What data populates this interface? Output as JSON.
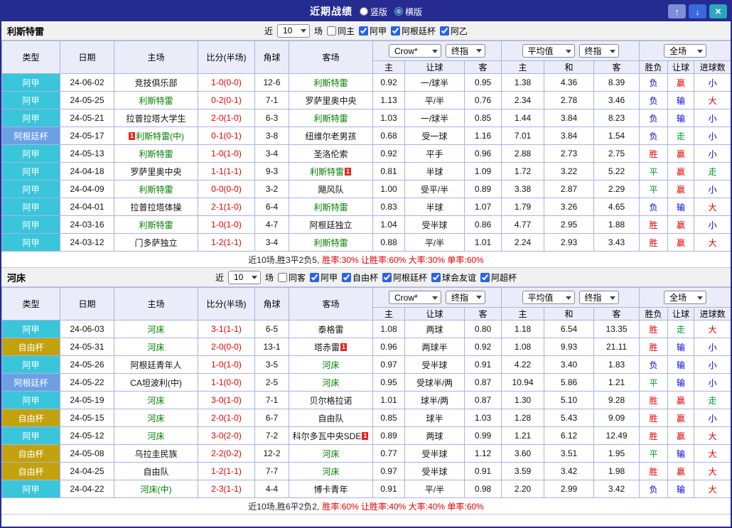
{
  "titlebar": {
    "title": "近期战绩",
    "layout_options": [
      {
        "label": "竖版",
        "checked": false
      },
      {
        "label": "横版",
        "checked": true
      }
    ],
    "buttons": {
      "up": "↑",
      "down": "↓",
      "close": "×"
    }
  },
  "table": {
    "main_headers": [
      "类型",
      "日期",
      "主场",
      "比分(半场)",
      "角球",
      "客场"
    ],
    "asia_source": "Crow*",
    "asia_final": "终指",
    "europe_source": "平均值",
    "europe_final": "终指",
    "scope": "全场",
    "sub_headers": [
      "主",
      "让球",
      "客",
      "主",
      "和",
      "客",
      "胜负",
      "让球",
      "进球数"
    ]
  },
  "colors": {
    "accent": "#262b8f",
    "focus_team": "#008000",
    "score": "#e60000",
    "league": {
      "阿甲": "#39c5da",
      "阿根廷杯": "#6ba0e5",
      "自由杯": "#c2a20d"
    },
    "result": {
      "胜": "#e60000",
      "平": "#009933",
      "负": "#0000e1",
      "赢": "#e60000",
      "输": "#0000e1",
      "走": "#009933",
      "大": "#e60000",
      "小": "#0000e1"
    }
  },
  "sections": [
    {
      "team": "利斯特雷",
      "filter": {
        "near": "近",
        "count": "10",
        "games": "场",
        "options": [
          {
            "label": "同主",
            "checked": false
          },
          {
            "label": "阿甲",
            "checked": true
          },
          {
            "label": "阿根廷杯",
            "checked": true
          },
          {
            "label": "阿乙",
            "checked": true
          }
        ]
      },
      "rows": [
        {
          "league": "阿甲",
          "date": "24-06-02",
          "home": "竞技俱乐部",
          "home_focus": false,
          "home_card": "",
          "score": "1-0(0-0)",
          "corner": "12-6",
          "away": "利斯特雷",
          "away_focus": true,
          "away_card": "",
          "ah": [
            "0.92",
            "一/球半",
            "0.95"
          ],
          "eu": [
            "1.38",
            "4.36",
            "8.39"
          ],
          "res": [
            "负",
            "赢",
            "小"
          ]
        },
        {
          "league": "阿甲",
          "date": "24-05-25",
          "home": "利斯特雷",
          "home_focus": true,
          "home_card": "",
          "score": "0-2(0-1)",
          "corner": "7-1",
          "away": "罗萨里奥中央",
          "away_focus": false,
          "away_card": "",
          "ah": [
            "1.13",
            "平/半",
            "0.76"
          ],
          "eu": [
            "2.34",
            "2.78",
            "3.46"
          ],
          "res": [
            "负",
            "输",
            "大"
          ]
        },
        {
          "league": "阿甲",
          "date": "24-05-21",
          "home": "拉普拉塔大学生",
          "home_focus": false,
          "home_card": "",
          "score": "2-0(1-0)",
          "corner": "6-3",
          "away": "利斯特雷",
          "away_focus": true,
          "away_card": "",
          "ah": [
            "1.03",
            "一/球半",
            "0.85"
          ],
          "eu": [
            "1.44",
            "3.84",
            "8.23"
          ],
          "res": [
            "负",
            "输",
            "小"
          ]
        },
        {
          "league": "阿根廷杯",
          "date": "24-05-17",
          "home": "利斯特雷(中)",
          "home_focus": true,
          "home_card": "pre",
          "score": "0-1(0-1)",
          "corner": "3-8",
          "away": "纽维尔老男孩",
          "away_focus": false,
          "away_card": "",
          "ah": [
            "0.68",
            "受一球",
            "1.16"
          ],
          "eu": [
            "7.01",
            "3.84",
            "1.54"
          ],
          "res": [
            "负",
            "走",
            "小"
          ]
        },
        {
          "league": "阿甲",
          "date": "24-05-13",
          "home": "利斯特雷",
          "home_focus": true,
          "home_card": "",
          "score": "1-0(1-0)",
          "corner": "3-4",
          "away": "圣洛伦索",
          "away_focus": false,
          "away_card": "",
          "ah": [
            "0.92",
            "平手",
            "0.96"
          ],
          "eu": [
            "2.88",
            "2.73",
            "2.75"
          ],
          "res": [
            "胜",
            "赢",
            "小"
          ]
        },
        {
          "league": "阿甲",
          "date": "24-04-18",
          "home": "罗萨里奥中央",
          "home_focus": false,
          "home_card": "",
          "score": "1-1(1-1)",
          "corner": "9-3",
          "away": "利斯特雷",
          "away_focus": true,
          "away_card": "post",
          "ah": [
            "0.81",
            "半球",
            "1.09"
          ],
          "eu": [
            "1.72",
            "3.22",
            "5.22"
          ],
          "res": [
            "平",
            "赢",
            "走"
          ]
        },
        {
          "league": "阿甲",
          "date": "24-04-09",
          "home": "利斯特雷",
          "home_focus": true,
          "home_card": "",
          "score": "0-0(0-0)",
          "corner": "3-2",
          "away": "飓风队",
          "away_focus": false,
          "away_card": "",
          "ah": [
            "1.00",
            "受平/半",
            "0.89"
          ],
          "eu": [
            "3.38",
            "2.87",
            "2.29"
          ],
          "res": [
            "平",
            "赢",
            "小"
          ]
        },
        {
          "league": "阿甲",
          "date": "24-04-01",
          "home": "拉普拉塔体操",
          "home_focus": false,
          "home_card": "",
          "score": "2-1(1-0)",
          "corner": "6-4",
          "away": "利斯特雷",
          "away_focus": true,
          "away_card": "",
          "ah": [
            "0.83",
            "半球",
            "1.07"
          ],
          "eu": [
            "1.79",
            "3.26",
            "4.65"
          ],
          "res": [
            "负",
            "输",
            "大"
          ]
        },
        {
          "league": "阿甲",
          "date": "24-03-16",
          "home": "利斯特雷",
          "home_focus": true,
          "home_card": "",
          "score": "1-0(1-0)",
          "corner": "4-7",
          "away": "阿根廷独立",
          "away_focus": false,
          "away_card": "",
          "ah": [
            "1.04",
            "受半球",
            "0.86"
          ],
          "eu": [
            "4.77",
            "2.95",
            "1.88"
          ],
          "res": [
            "胜",
            "赢",
            "小"
          ]
        },
        {
          "league": "阿甲",
          "date": "24-03-12",
          "home": "门多萨独立",
          "home_focus": false,
          "home_card": "",
          "score": "1-2(1-1)",
          "corner": "3-4",
          "away": "利斯特雷",
          "away_focus": true,
          "away_card": "",
          "ah": [
            "0.88",
            "平/半",
            "1.01"
          ],
          "eu": [
            "2.24",
            "2.93",
            "3.43"
          ],
          "res": [
            "胜",
            "赢",
            "大"
          ]
        }
      ],
      "summary_prefix": "近10场,胜3平2负5,",
      "summary_stats": "胜率:30% 让胜率:60% 大率:30% 单率:60%"
    },
    {
      "team": "河床",
      "filter": {
        "near": "近",
        "count": "10",
        "games": "场",
        "options": [
          {
            "label": "同客",
            "checked": false
          },
          {
            "label": "阿甲",
            "checked": true
          },
          {
            "label": "自由杯",
            "checked": true
          },
          {
            "label": "阿根廷杯",
            "checked": true
          },
          {
            "label": "球会友谊",
            "checked": true
          },
          {
            "label": "阿超杯",
            "checked": true
          }
        ]
      },
      "rows": [
        {
          "league": "阿甲",
          "date": "24-06-03",
          "home": "河床",
          "home_focus": true,
          "home_card": "",
          "score": "3-1(1-1)",
          "corner": "6-5",
          "away": "泰格雷",
          "away_focus": false,
          "away_card": "",
          "ah": [
            "1.08",
            "两球",
            "0.80"
          ],
          "eu": [
            "1.18",
            "6.54",
            "13.35"
          ],
          "res": [
            "胜",
            "走",
            "大"
          ]
        },
        {
          "league": "自由杯",
          "date": "24-05-31",
          "home": "河床",
          "home_focus": true,
          "home_card": "",
          "score": "2-0(0-0)",
          "corner": "13-1",
          "away": "塔赤雷",
          "away_focus": false,
          "away_card": "post",
          "ah": [
            "0.96",
            "两球半",
            "0.92"
          ],
          "eu": [
            "1.08",
            "9.93",
            "21.11"
          ],
          "res": [
            "胜",
            "输",
            "小"
          ]
        },
        {
          "league": "阿甲",
          "date": "24-05-26",
          "home": "阿根廷青年人",
          "home_focus": false,
          "home_card": "",
          "score": "1-0(1-0)",
          "corner": "3-5",
          "away": "河床",
          "away_focus": true,
          "away_card": "",
          "ah": [
            "0.97",
            "受半球",
            "0.91"
          ],
          "eu": [
            "4.22",
            "3.40",
            "1.83"
          ],
          "res": [
            "负",
            "输",
            "小"
          ]
        },
        {
          "league": "阿根廷杯",
          "date": "24-05-22",
          "home": "CA坦波利(中)",
          "home_focus": false,
          "home_card": "",
          "score": "1-1(0-0)",
          "corner": "2-5",
          "away": "河床",
          "away_focus": true,
          "away_card": "",
          "ah": [
            "0.95",
            "受球半/两",
            "0.87"
          ],
          "eu": [
            "10.94",
            "5.86",
            "1.21"
          ],
          "res": [
            "平",
            "输",
            "小"
          ]
        },
        {
          "league": "阿甲",
          "date": "24-05-19",
          "home": "河床",
          "home_focus": true,
          "home_card": "",
          "score": "3-0(1-0)",
          "corner": "7-1",
          "away": "贝尔格拉诺",
          "away_focus": false,
          "away_card": "",
          "ah": [
            "1.01",
            "球半/两",
            "0.87"
          ],
          "eu": [
            "1.30",
            "5.10",
            "9.28"
          ],
          "res": [
            "胜",
            "赢",
            "走"
          ]
        },
        {
          "league": "自由杯",
          "date": "24-05-15",
          "home": "河床",
          "home_focus": true,
          "home_card": "",
          "score": "2-0(1-0)",
          "corner": "6-7",
          "away": "自由队",
          "away_focus": false,
          "away_card": "",
          "ah": [
            "0.85",
            "球半",
            "1.03"
          ],
          "eu": [
            "1.28",
            "5.43",
            "9.09"
          ],
          "res": [
            "胜",
            "赢",
            "小"
          ]
        },
        {
          "league": "阿甲",
          "date": "24-05-12",
          "home": "河床",
          "home_focus": true,
          "home_card": "",
          "score": "3-0(2-0)",
          "corner": "7-2",
          "away": "科尔多瓦中央SDE",
          "away_focus": false,
          "away_card": "post",
          "ah": [
            "0.89",
            "两球",
            "0.99"
          ],
          "eu": [
            "1.21",
            "6.12",
            "12.49"
          ],
          "res": [
            "胜",
            "赢",
            "大"
          ]
        },
        {
          "league": "自由杯",
          "date": "24-05-08",
          "home": "乌拉圭民族",
          "home_focus": false,
          "home_card": "",
          "score": "2-2(0-2)",
          "corner": "12-2",
          "away": "河床",
          "away_focus": true,
          "away_card": "",
          "ah": [
            "0.77",
            "受半球",
            "1.12"
          ],
          "eu": [
            "3.60",
            "3.51",
            "1.95"
          ],
          "res": [
            "平",
            "输",
            "大"
          ]
        },
        {
          "league": "自由杯",
          "date": "24-04-25",
          "home": "自由队",
          "home_focus": false,
          "home_card": "",
          "score": "1-2(1-1)",
          "corner": "7-7",
          "away": "河床",
          "away_focus": true,
          "away_card": "",
          "ah": [
            "0.97",
            "受半球",
            "0.91"
          ],
          "eu": [
            "3.59",
            "3.42",
            "1.98"
          ],
          "res": [
            "胜",
            "赢",
            "大"
          ]
        },
        {
          "league": "阿甲",
          "date": "24-04-22",
          "home": "河床(中)",
          "home_focus": true,
          "home_card": "",
          "score": "2-3(1-1)",
          "corner": "4-4",
          "away": "博卡青年",
          "away_focus": false,
          "away_card": "",
          "ah": [
            "0.91",
            "平/半",
            "0.98"
          ],
          "eu": [
            "2.20",
            "2.99",
            "3.42"
          ],
          "res": [
            "负",
            "输",
            "大"
          ]
        }
      ],
      "summary_prefix": "近10场,胜6平2负2,",
      "summary_stats": "胜率:60% 让胜率:40% 大率:40% 单率:60%"
    }
  ]
}
